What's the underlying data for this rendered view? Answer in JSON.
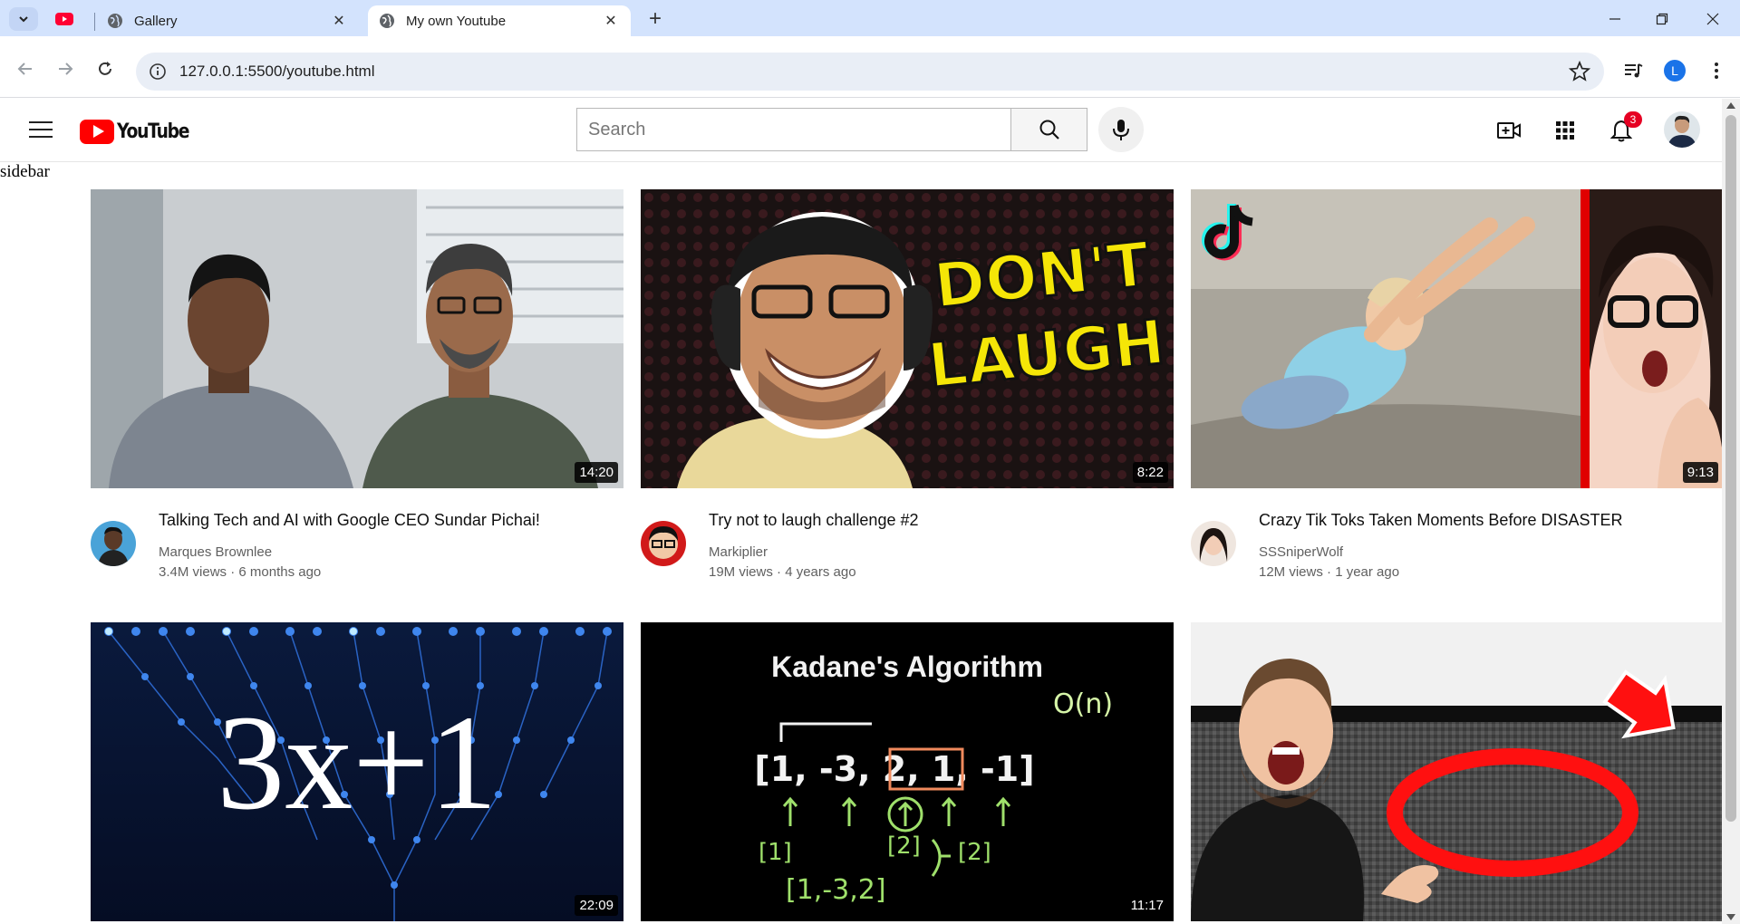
{
  "browser": {
    "tabs": [
      {
        "title": "Gallery"
      },
      {
        "title": "My own Youtube"
      }
    ],
    "url": "127.0.0.1:5500/youtube.html",
    "profile_initial": "L"
  },
  "header": {
    "logo_text": "YouTube",
    "search_placeholder": "Search",
    "notification_count": "3"
  },
  "sidebar": {
    "label": "sidebar"
  },
  "videos": [
    {
      "title": "Talking Tech and AI with Google CEO Sundar Pichai!",
      "channel": "Marques Brownlee",
      "views": "3.4M views",
      "age": "6 months ago",
      "duration": "14:20"
    },
    {
      "title": "Try not to laugh challenge #2",
      "channel": "Markiplier",
      "views": "19M views",
      "age": "4 years ago",
      "duration": "8:22"
    },
    {
      "title": "Crazy Tik Toks Taken Moments Before DISASTER",
      "channel": "SSSniperWolf",
      "views": "12M views",
      "age": "1 year ago",
      "duration": "9:13"
    },
    {
      "title": "",
      "channel": "",
      "views": "",
      "age": "",
      "duration": "22:09"
    },
    {
      "title": "",
      "channel": "",
      "views": "",
      "age": "",
      "duration": "11:17"
    },
    {
      "title": "",
      "channel": "",
      "views": "",
      "age": "",
      "duration": ""
    }
  ],
  "thumb_text": {
    "laugh_line1": "DON'T",
    "laugh_line2": "LAUGH",
    "collatz": "3x+1",
    "kadane_title": "Kadane's Algorithm",
    "kadane_array": "[1, -3, 2, 1, -1]",
    "kadane_complexity": "O(n)",
    "kadane_sub1": "[1]",
    "kadane_sub2": "[2]",
    "kadane_sub3": "[1,-3,2]",
    "kadane_sub4": "[2]"
  },
  "colors": {
    "youtube_red": "#ff0000",
    "chrome_tab_bar": "#d3e3fd",
    "notification_badge": "#e60023"
  }
}
